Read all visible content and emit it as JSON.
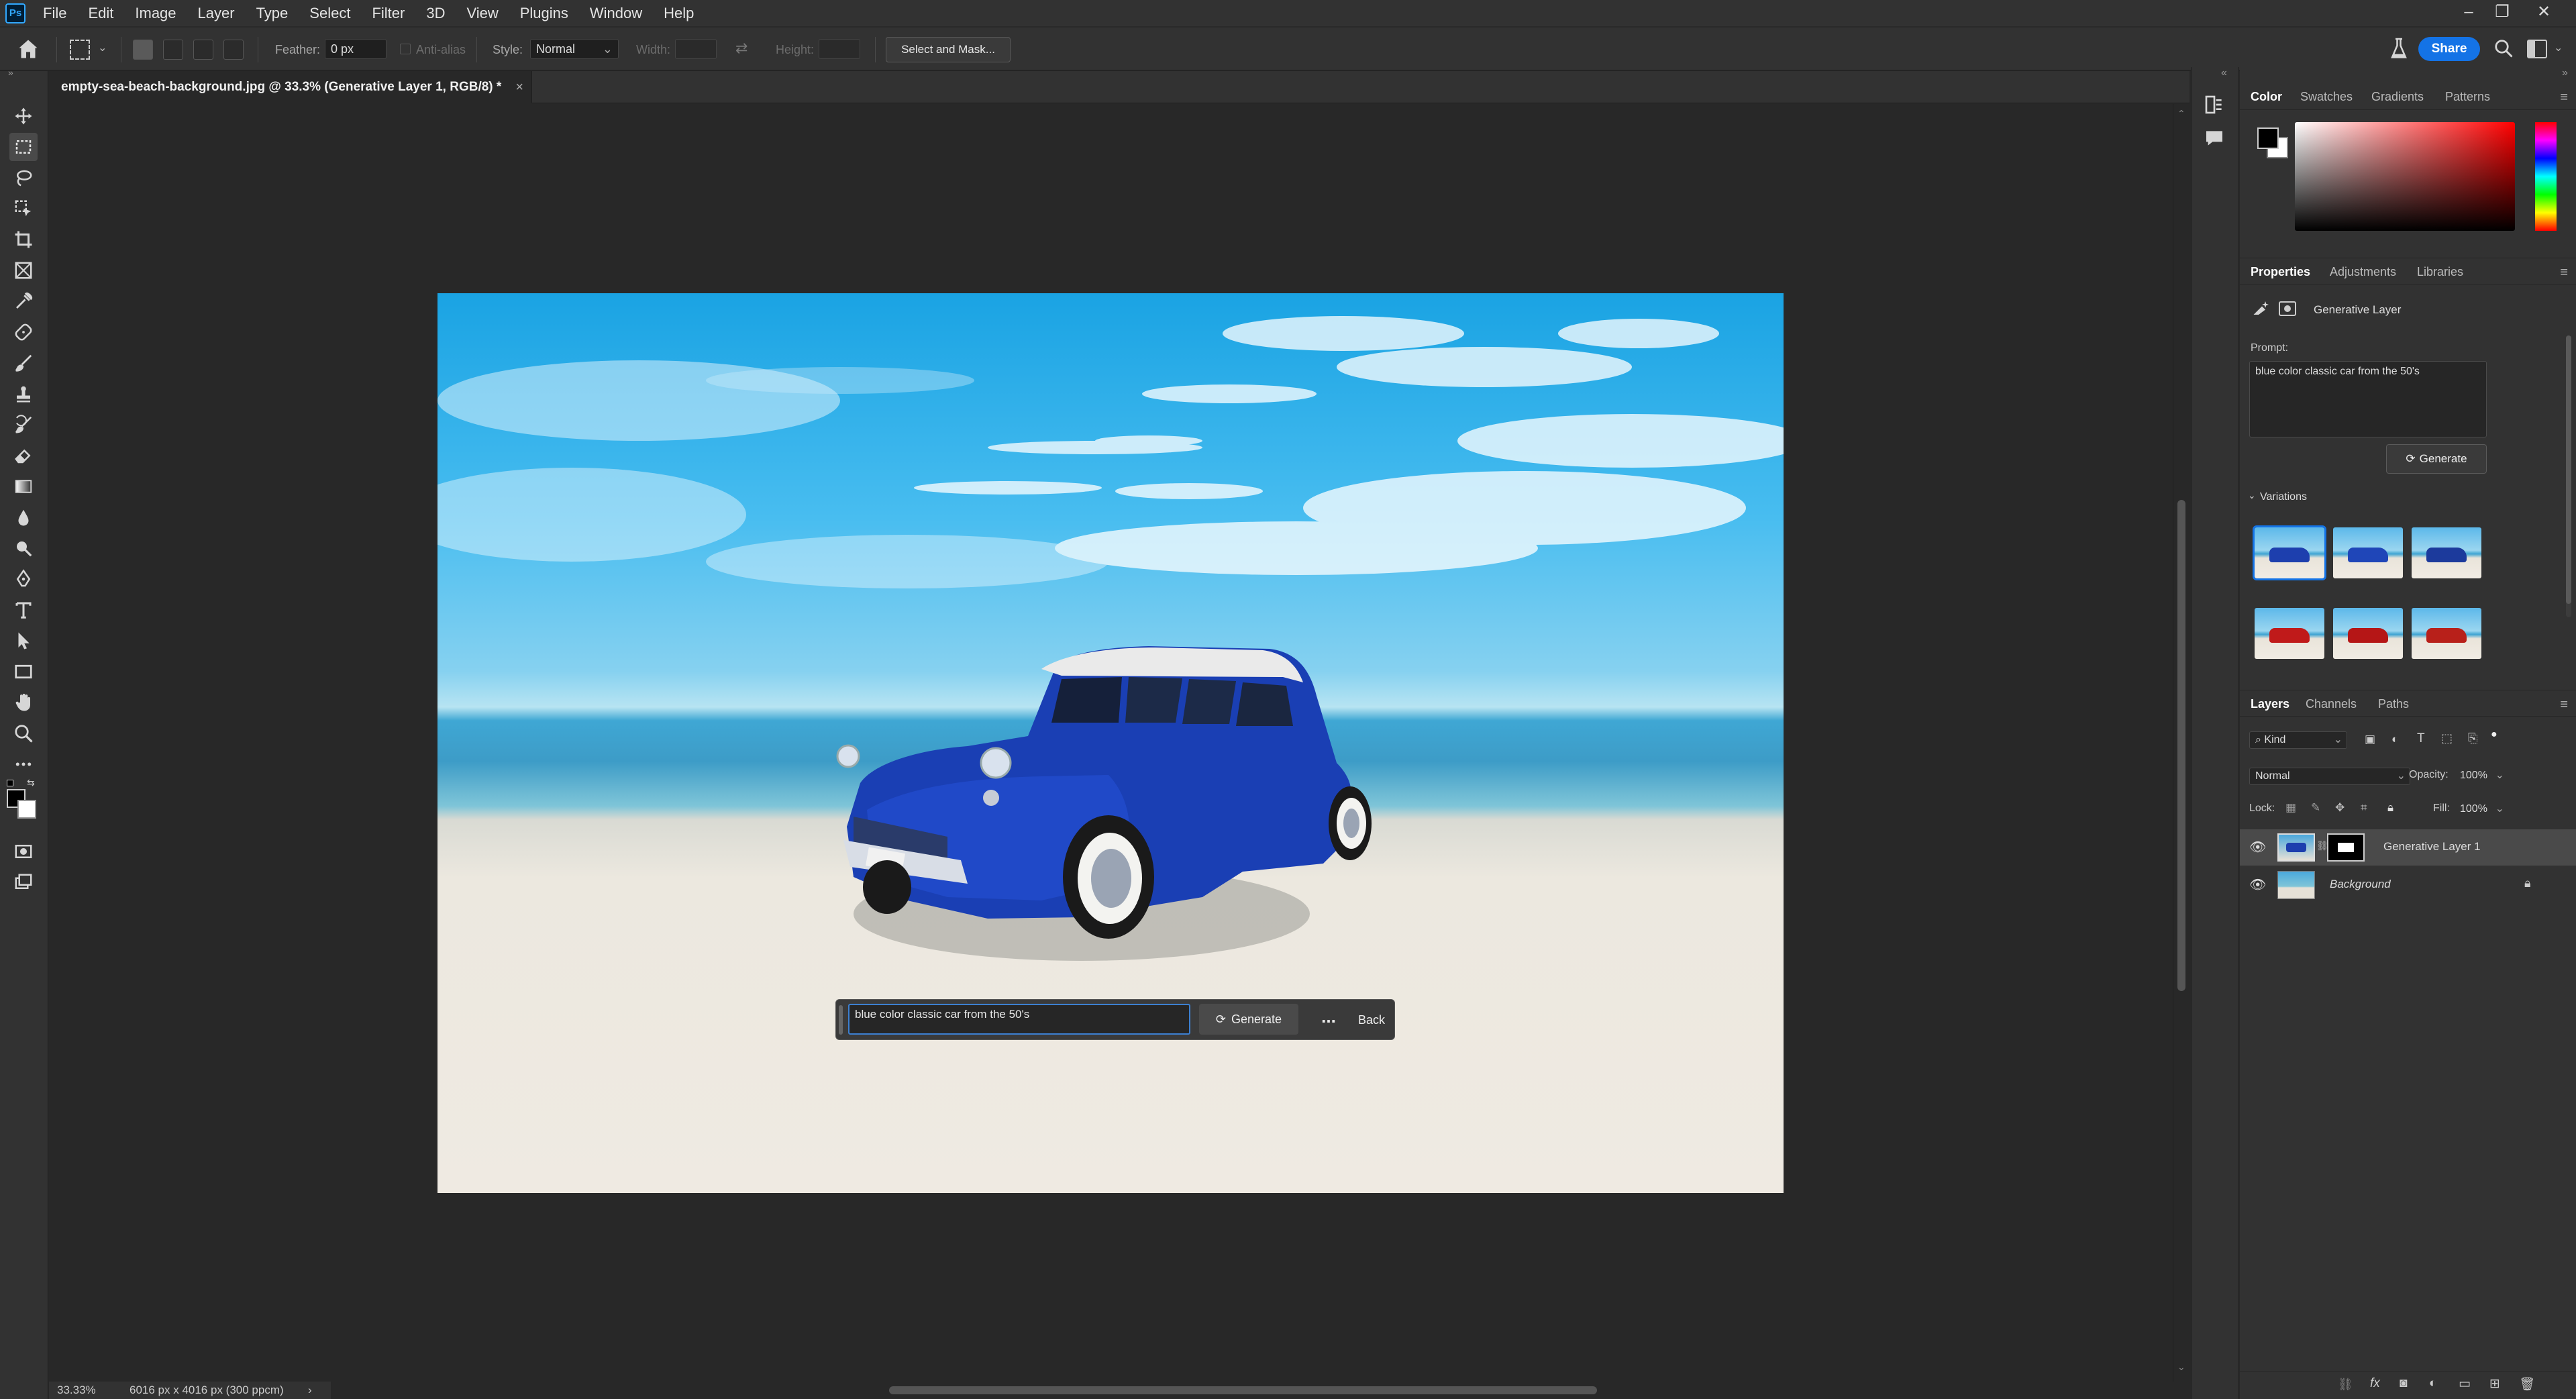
{
  "app": {
    "name": "Adobe Photoshop",
    "logo": "Ps"
  },
  "menu": [
    "File",
    "Edit",
    "Image",
    "Layer",
    "Type",
    "Select",
    "Filter",
    "3D",
    "View",
    "Plugins",
    "Window",
    "Help"
  ],
  "options_bar": {
    "feather_label": "Feather:",
    "feather_value": "0 px",
    "anti_alias_label": "Anti-alias",
    "style_label": "Style:",
    "style_value": "Normal",
    "width_label": "Width:",
    "height_label": "Height:",
    "select_mask_label": "Select and Mask...",
    "share_label": "Share"
  },
  "document": {
    "tab_title": "empty-sea-beach-background.jpg @ 33.3% (Generative Layer 1, RGB/8) *",
    "close_glyph": "×"
  },
  "context_bar": {
    "prompt_value": "blue color classic car from the 50's",
    "generate_label": "Generate",
    "more_label": "...",
    "back_label": "Back"
  },
  "status": {
    "zoom": "33.33%",
    "doc_info": "6016 px x 4016 px (300 ppcm)",
    "arrow": "›"
  },
  "color_panel": {
    "tabs": [
      "Color",
      "Swatches",
      "Gradients",
      "Patterns"
    ],
    "active": "Color",
    "foreground": "#000000",
    "background": "#ffffff",
    "hue": "#ff0000"
  },
  "properties_panel": {
    "tabs": [
      "Properties",
      "Adjustments",
      "Libraries"
    ],
    "active": "Properties",
    "layer_type": "Generative Layer",
    "prompt_label": "Prompt:",
    "prompt_value": "blue color classic car from the 50's",
    "generate_label": "Generate",
    "variations_label": "Variations",
    "variations": [
      {
        "name": "variation-1",
        "car_color": "#1d3fae",
        "selected": true
      },
      {
        "name": "variation-2",
        "car_color": "#1f46b8",
        "selected": false
      },
      {
        "name": "variation-3",
        "car_color": "#1c3a9c",
        "selected": false
      },
      {
        "name": "variation-4",
        "car_color": "#c01a1a",
        "selected": false
      },
      {
        "name": "variation-5",
        "car_color": "#b51616",
        "selected": false
      },
      {
        "name": "variation-6",
        "car_color": "#b8201a",
        "selected": false
      }
    ]
  },
  "layers_panel": {
    "tabs": [
      "Layers",
      "Channels",
      "Paths"
    ],
    "active": "Layers",
    "kind_label": "Kind",
    "blend_mode": "Normal",
    "opacity_label": "Opacity:",
    "opacity_value": "100%",
    "lock_label": "Lock:",
    "fill_label": "Fill:",
    "fill_value": "100%",
    "layers": [
      {
        "name": "Generative Layer 1",
        "selected": true
      },
      {
        "name": "Background",
        "selected": false,
        "locked": true
      }
    ]
  },
  "colors": {
    "accent": "#1473e6",
    "panel": "#323232",
    "canvas_bg": "#282828"
  }
}
